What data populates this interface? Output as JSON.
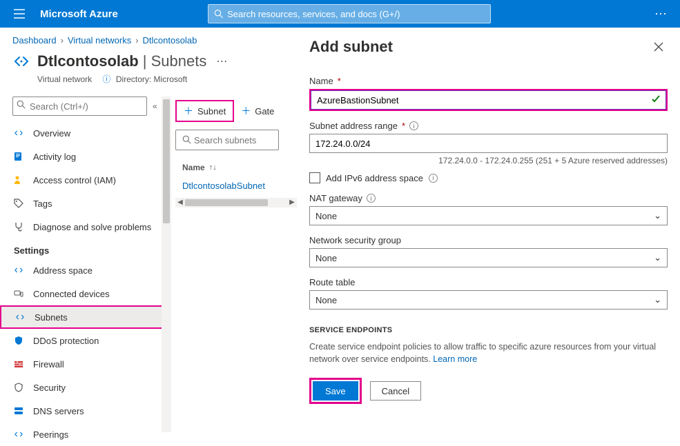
{
  "topbar": {
    "brand": "Microsoft Azure",
    "search_placeholder": "Search resources, services, and docs (G+/)"
  },
  "breadcrumbs": {
    "items": [
      "Dashboard",
      "Virtual networks",
      "Dtlcontosolab"
    ]
  },
  "page": {
    "title_main": "Dtlcontosolab",
    "title_sub": "Subnets",
    "subtitle_type": "Virtual network",
    "subtitle_dir_label": "Directory:",
    "subtitle_dir_value": "Microsoft"
  },
  "sidenav": {
    "search_placeholder": "Search (Ctrl+/)",
    "items_top": [
      {
        "label": "Overview",
        "icon": "vnet"
      },
      {
        "label": "Activity log",
        "icon": "log"
      },
      {
        "label": "Access control (IAM)",
        "icon": "iam"
      },
      {
        "label": "Tags",
        "icon": "tag"
      },
      {
        "label": "Diagnose and solve problems",
        "icon": "diag"
      }
    ],
    "group_settings_label": "Settings",
    "items_settings": [
      {
        "label": "Address space",
        "icon": "vnet"
      },
      {
        "label": "Connected devices",
        "icon": "devices"
      },
      {
        "label": "Subnets",
        "icon": "vnet",
        "selected": true
      },
      {
        "label": "DDoS protection",
        "icon": "shield"
      },
      {
        "label": "Firewall",
        "icon": "firewall"
      },
      {
        "label": "Security",
        "icon": "security"
      },
      {
        "label": "DNS servers",
        "icon": "dns"
      },
      {
        "label": "Peerings",
        "icon": "peer"
      }
    ]
  },
  "mid": {
    "toolbar": {
      "subnet_btn": "Subnet",
      "gateway_btn": "Gate"
    },
    "search_placeholder": "Search subnets",
    "table": {
      "col_name": "Name",
      "rows": [
        {
          "name": "DtlcontosolabSubnet"
        }
      ]
    }
  },
  "blade": {
    "title": "Add subnet",
    "name_label": "Name",
    "name_value": "AzureBastionSubnet",
    "addr_label": "Subnet address range",
    "addr_value": "172.24.0.0/24",
    "addr_hint": "172.24.0.0 - 172.24.0.255 (251 + 5 Azure reserved addresses)",
    "ipv6_label": "Add IPv6 address space",
    "nat_label": "NAT gateway",
    "nat_value": "None",
    "nsg_label": "Network security group",
    "nsg_value": "None",
    "route_label": "Route table",
    "route_value": "None",
    "endpoints_heading": "SERVICE ENDPOINTS",
    "endpoints_desc": "Create service endpoint policies to allow traffic to specific azure resources from your virtual network over service endpoints.",
    "learn_more": "Learn more",
    "save_label": "Save",
    "cancel_label": "Cancel"
  }
}
